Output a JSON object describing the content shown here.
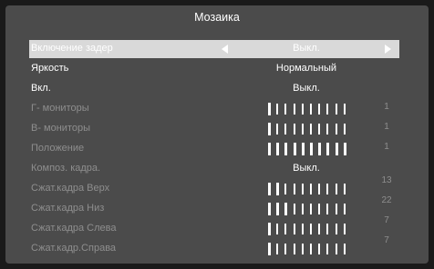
{
  "menu": {
    "title": "Мозаика",
    "items": [
      {
        "label": "Включение задер",
        "value": "Выкл."
      },
      {
        "label": "Яркость",
        "value": "Нормальный"
      },
      {
        "label": "Вкл.",
        "value": "Выкл."
      },
      {
        "label": "Г- мониторы",
        "level": 1,
        "max": 10
      },
      {
        "label": "В- мониторы",
        "level": 1,
        "max": 10
      },
      {
        "label": "Положение",
        "level": 10,
        "max": 10
      },
      {
        "label": "Композ. кадра.",
        "value": "Выкл."
      },
      {
        "label": "Сжат.кадра Верх",
        "level": 2,
        "max": 10,
        "number": "13"
      },
      {
        "label": "Сжат.кадра Низ",
        "level": 3,
        "max": 10,
        "number": "22"
      },
      {
        "label": "Сжат.кадра Слева",
        "level": 1,
        "max": 10,
        "number": "7"
      },
      {
        "label": "Сжат.кадр.Справа",
        "level": 1,
        "max": 10,
        "number": "7"
      }
    ],
    "numbers": [
      "1",
      "1",
      "1"
    ]
  }
}
